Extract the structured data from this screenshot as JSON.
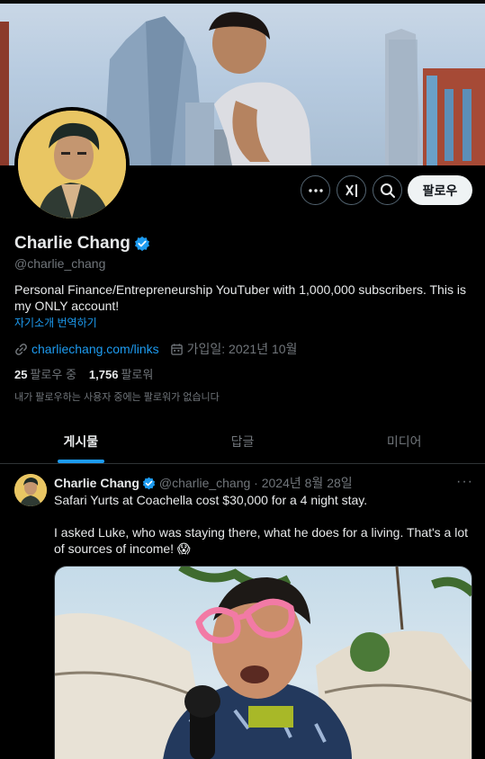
{
  "profile": {
    "display_name": "Charlie Chang",
    "handle": "@charlie_chang",
    "bio": "Personal Finance/Entrepreneurship YouTuber with 1,000,000 subscribers. This is my ONLY account!",
    "translate_bio": "자기소개 번역하기",
    "website": "charliechang.com/links",
    "joined": "가입일: 2021년 10월",
    "following_count": "25",
    "following_label": "팔로우 중",
    "followers_count": "1,756",
    "followers_label": "팔로워",
    "not_followed_note": "내가 팔로우하는 사용자 중에는 팔로워가 없습니다"
  },
  "actions": {
    "follow_label": "팔로우"
  },
  "tabs": [
    {
      "label": "게시물",
      "active": true
    },
    {
      "label": "답글",
      "active": false
    },
    {
      "label": "미디어",
      "active": false
    }
  ],
  "tweet": {
    "name": "Charlie Chang",
    "handle_date": "@charlie_chang · 2024년 8월 28일",
    "text": "Safari Yurts at Coachella cost $30,000 for a 4 night stay.\n\nI asked Luke, who was staying there, what he does for a living. That's a lot of sources of income! 😱",
    "more": "···"
  },
  "colors": {
    "accent": "#1d9bf0",
    "background": "#000000",
    "muted_text": "#71767b"
  },
  "icons": [
    "more-icon",
    "grok-icon",
    "search-icon",
    "verified-badge-icon",
    "link-icon",
    "calendar-icon"
  ]
}
